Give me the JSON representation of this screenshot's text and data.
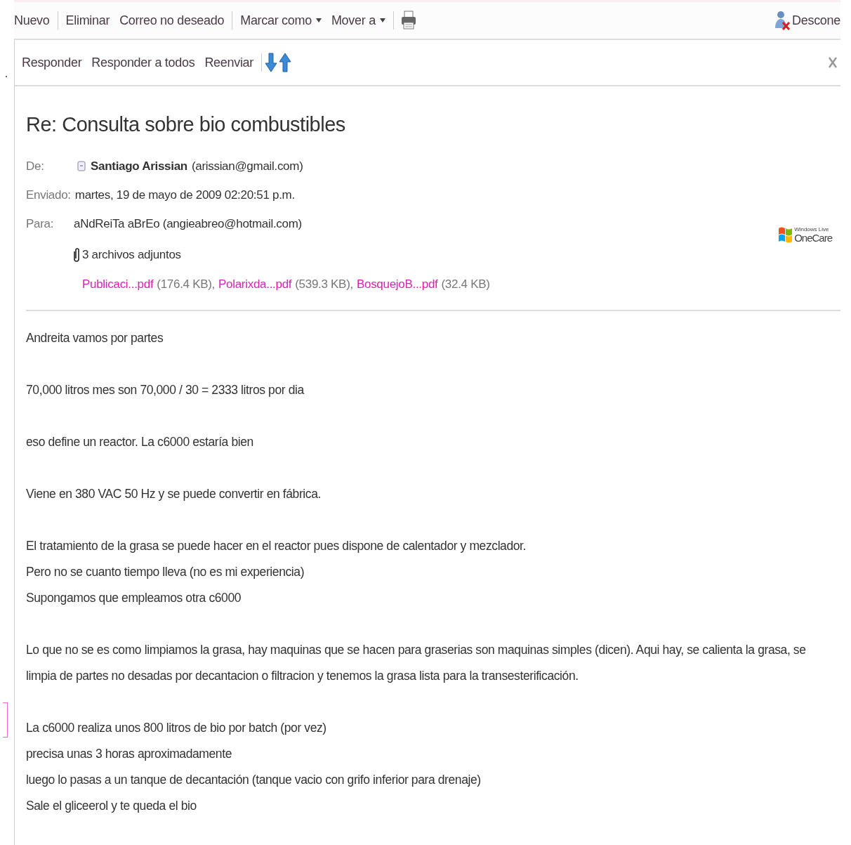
{
  "toolbar": {
    "items": [
      {
        "label": "Nuevo",
        "kind": "button"
      },
      {
        "kind": "divider"
      },
      {
        "label": "Eliminar",
        "kind": "button"
      },
      {
        "label": "Correo no deseado",
        "kind": "button"
      },
      {
        "kind": "divider"
      },
      {
        "label": "Marcar como",
        "kind": "menu"
      },
      {
        "label": "Mover a",
        "kind": "menu"
      },
      {
        "kind": "divider"
      },
      {
        "kind": "print"
      }
    ],
    "account": "Descone"
  },
  "message_actions": {
    "items": [
      "Responder",
      "Responder a todos",
      "Reenviar"
    ]
  },
  "subject": "Re: Consulta sobre bio combustibles",
  "from": {
    "label": "De:",
    "name": "Santiago Arissian",
    "email": "(arissian@gmail.com)"
  },
  "sent": {
    "label": "Enviado:",
    "value": "martes, 19 de mayo de 2009 02:20:51 p.m."
  },
  "to": {
    "label": "Para:",
    "value": "aNdReiTa aBrEo (angieabreo@hotmail.com)"
  },
  "attachments": {
    "summary": "3 archivos adjuntos",
    "files": [
      {
        "name": "Publicaci...pdf",
        "size": "(176.4 KB),"
      },
      {
        "name": "Polarixda...pdf",
        "size": "(539.3 KB),"
      },
      {
        "name": "BosquejoB...pdf",
        "size": "(32.4 KB)"
      }
    ]
  },
  "ad_logo": {
    "line1": "Windows Live",
    "line2": "OneCare"
  },
  "body": [
    [
      "Andreita vamos por partes"
    ],
    [
      "70,000 litros mes son 70,000 / 30 = 2333 litros por dia"
    ],
    [
      "eso define un reactor. La c6000 estaría bien"
    ],
    [
      "Viene en 380 VAC 50 Hz y se puede convertir en fábrica."
    ],
    [
      "El tratamiento de la grasa se puede hacer en el reactor pues dispone de calentador y mezclador.",
      "Pero no se cuanto tiempo lleva (no es mi experiencia)",
      "Supongamos que empleamos otra c6000"
    ],
    [
      "Lo que no se es como limpiamos la grasa, hay maquinas que se hacen para graserias son maquinas simples (dicen). Aqui hay, se calienta la grasa, se limpia de partes no desadas por decantacion o filtracion y tenemos la grasa lista para la transesterificación."
    ],
    [
      "La c6000 realiza unos 800 litros de bio por batch (por vez)",
      "precisa unas 3 horas aproximadamente",
      "luego lo pasas a un tanque de decantación (tanque vacio con grifo inferior para drenaje)",
      "Sale el gliceerol y te queda el bio"
    ]
  ]
}
